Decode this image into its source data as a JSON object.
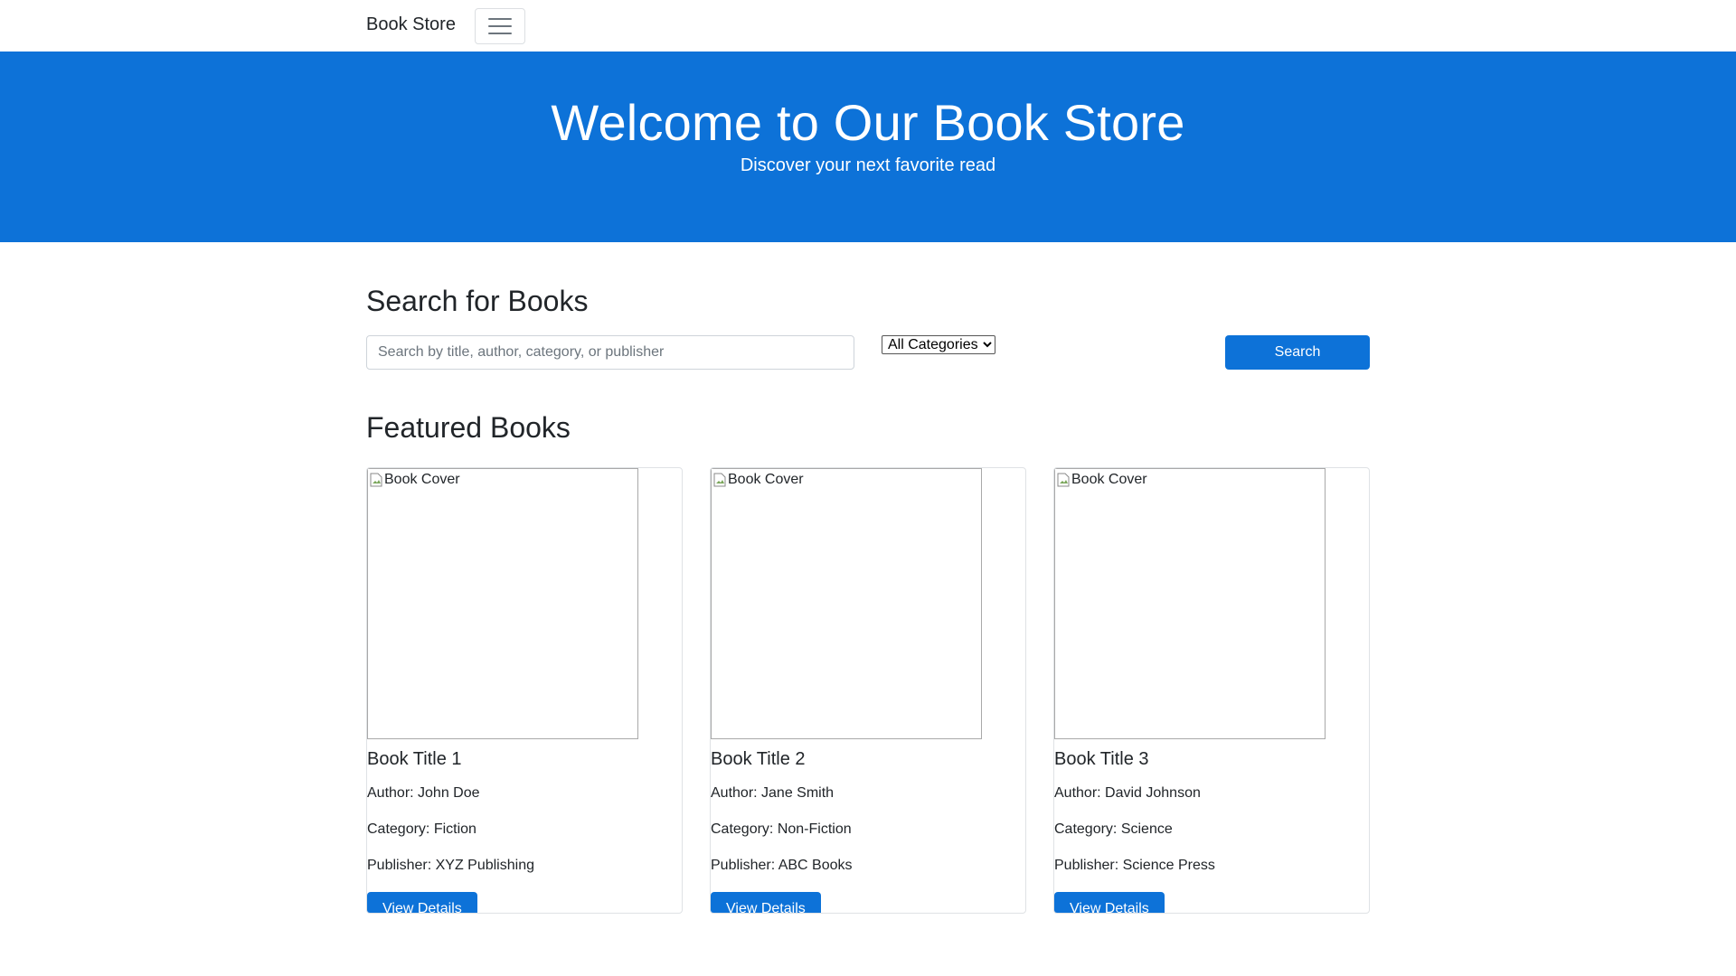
{
  "navbar": {
    "brand": "Book Store",
    "toggler_icon": "hamburger-menu-icon"
  },
  "hero": {
    "title": "Welcome to Our Book Store",
    "subtitle": "Discover your next favorite read"
  },
  "search": {
    "heading": "Search for Books",
    "placeholder": "Search by title, author, category, or publisher",
    "value": "",
    "category_selected": "All Categories",
    "button_label": "Search"
  },
  "featured": {
    "heading": "Featured Books",
    "books": [
      {
        "cover_alt": "Book Cover",
        "title": "Book Title 1",
        "author": "Author: John Doe",
        "category": "Category: Fiction",
        "publisher": "Publisher: XYZ Publishing",
        "button_label": "View Details"
      },
      {
        "cover_alt": "Book Cover",
        "title": "Book Title 2",
        "author": "Author: Jane Smith",
        "category": "Category: Non-Fiction",
        "publisher": "Publisher: ABC Books",
        "button_label": "View Details"
      },
      {
        "cover_alt": "Book Cover",
        "title": "Book Title 3",
        "author": "Author: David Johnson",
        "category": "Category: Science",
        "publisher": "Publisher: Science Press",
        "button_label": "View Details"
      }
    ]
  },
  "colors": {
    "primary": "#0d72d8",
    "text": "#212529",
    "border": "#dfe2e5"
  }
}
